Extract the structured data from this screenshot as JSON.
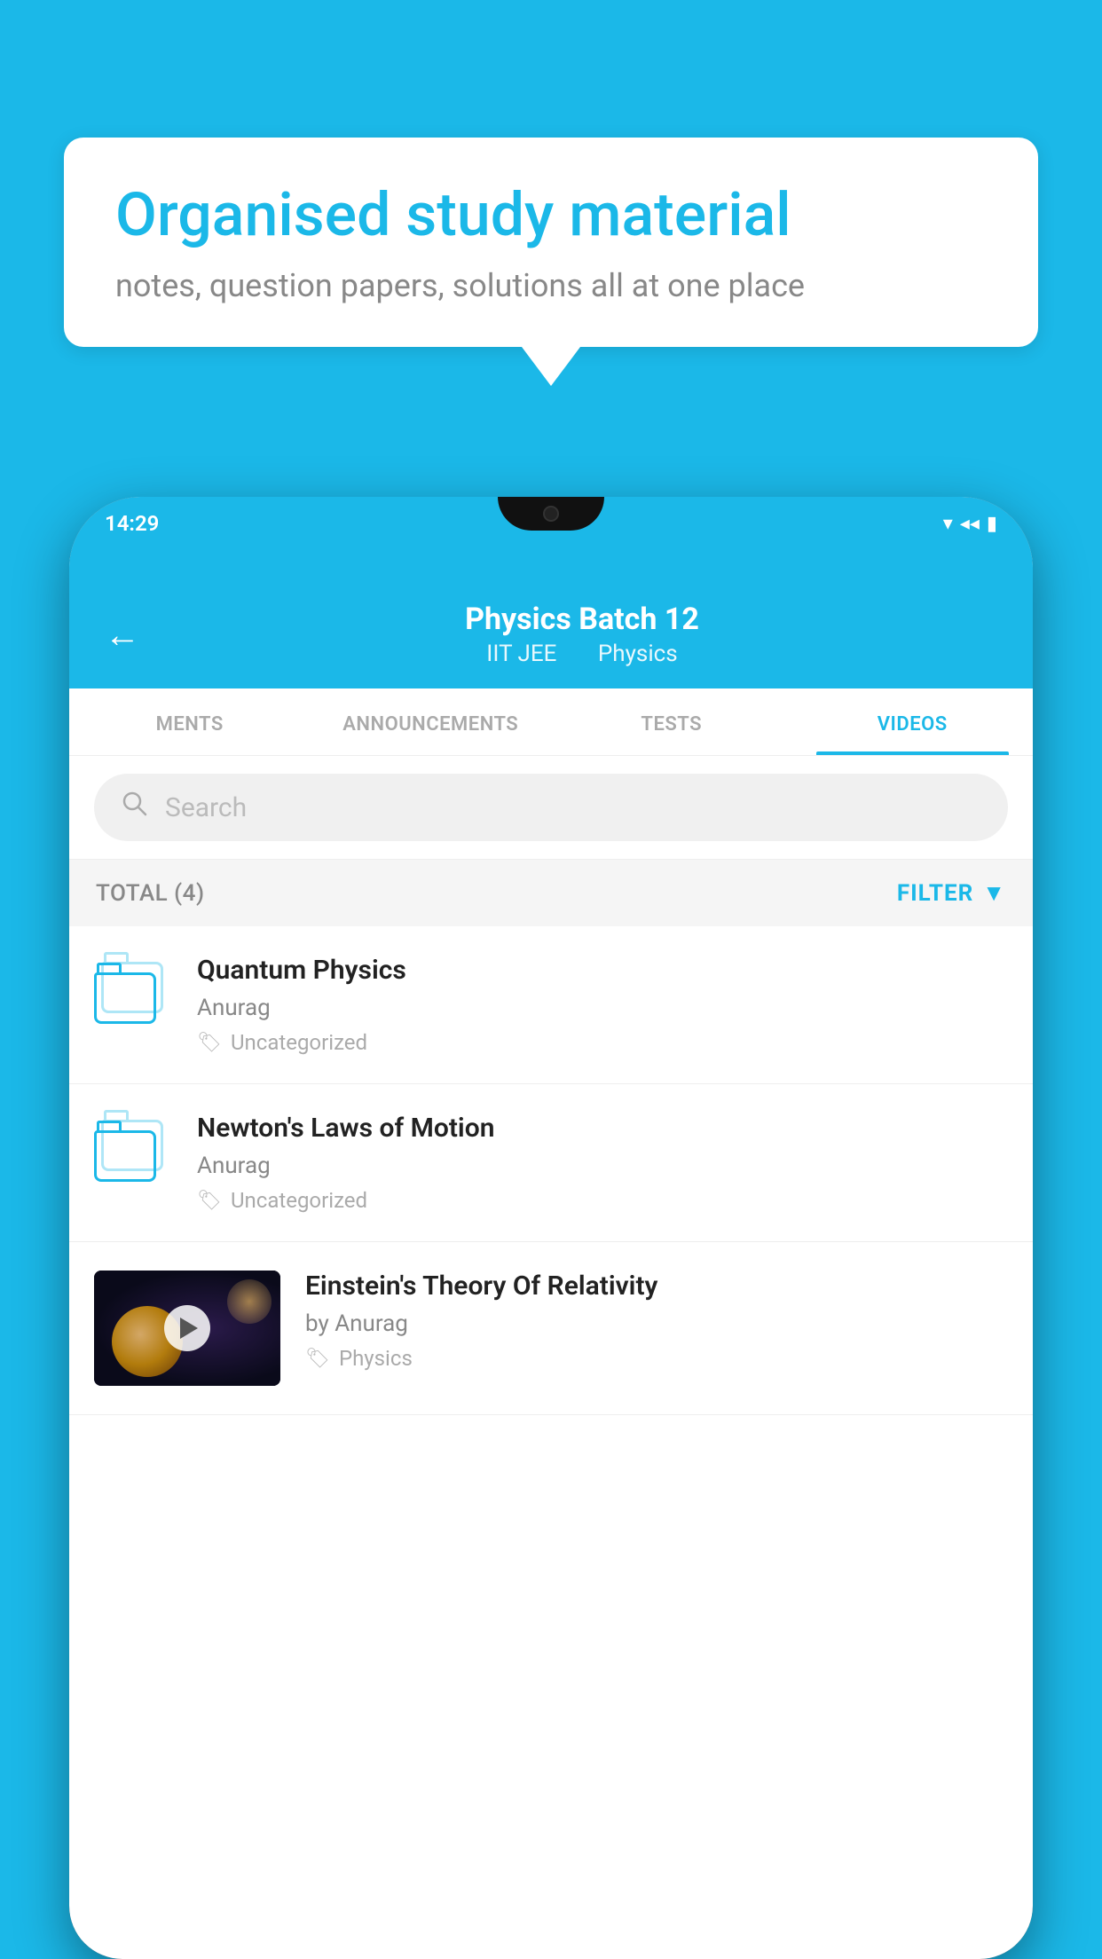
{
  "background": {
    "color": "#1bb8e8"
  },
  "speech_bubble": {
    "title": "Organised study material",
    "subtitle": "notes, question papers, solutions all at one place"
  },
  "phone": {
    "status_bar": {
      "time": "14:29",
      "wifi_icon": "wifi-icon",
      "signal_icon": "signal-icon",
      "battery_icon": "battery-icon"
    },
    "header": {
      "title": "Physics Batch 12",
      "subtitle_part1": "IIT JEE",
      "subtitle_part2": "Physics",
      "back_label": "←"
    },
    "tabs": [
      {
        "label": "MENTS",
        "active": false
      },
      {
        "label": "ANNOUNCEMENTS",
        "active": false
      },
      {
        "label": "TESTS",
        "active": false
      },
      {
        "label": "VIDEOS",
        "active": true
      }
    ],
    "search": {
      "placeholder": "Search"
    },
    "filter_bar": {
      "total_label": "TOTAL (4)",
      "filter_label": "FILTER"
    },
    "videos": [
      {
        "id": 1,
        "title": "Quantum Physics",
        "author": "Anurag",
        "tag": "Uncategorized",
        "has_thumbnail": false
      },
      {
        "id": 2,
        "title": "Newton's Laws of Motion",
        "author": "Anurag",
        "tag": "Uncategorized",
        "has_thumbnail": false
      },
      {
        "id": 3,
        "title": "Einstein's Theory Of Relativity",
        "author": "by Anurag",
        "tag": "Physics",
        "has_thumbnail": true
      }
    ]
  }
}
